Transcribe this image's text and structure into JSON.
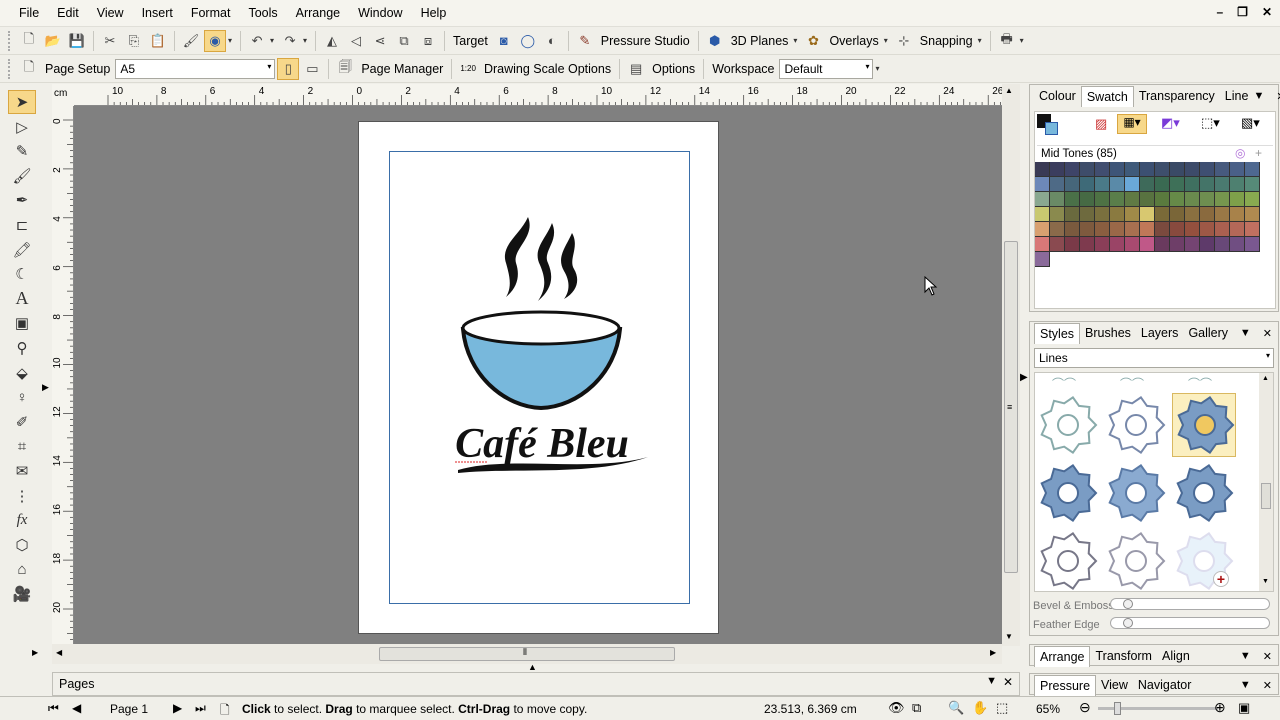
{
  "menu": [
    "File",
    "Edit",
    "View",
    "Insert",
    "Format",
    "Tools",
    "Arrange",
    "Window",
    "Help"
  ],
  "toolbar1": {
    "target_label": "Target",
    "pressure_studio_label": "Pressure Studio",
    "planes_label": "3D Planes",
    "overlays_label": "Overlays",
    "snapping_label": "Snapping"
  },
  "toolbar2": {
    "page_setup_label": "Page Setup",
    "page_size_value": "A5",
    "page_manager_label": "Page Manager",
    "scale_icon_text": "1:20",
    "drawing_scale_label": "Drawing Scale Options",
    "options_label": "Options",
    "workspace_label": "Workspace",
    "workspace_value": "Default"
  },
  "ruler": {
    "unit": "cm",
    "h_ticks": [
      "10",
      "8",
      "6",
      "4",
      "2",
      "0",
      "2",
      "4",
      "6",
      "8",
      "10",
      "12",
      "14",
      "16",
      "18",
      "20",
      "22",
      "24",
      "26"
    ],
    "v_ticks": [
      "0",
      "2",
      "4",
      "6",
      "8",
      "10",
      "12",
      "14",
      "16",
      "18",
      "20"
    ]
  },
  "artwork": {
    "title": "Café Bleu",
    "bowl_color": "#78b8dc"
  },
  "colour_panel": {
    "tabs": [
      "Colour",
      "Swatch",
      "Transparency",
      "Line"
    ],
    "active_tab": "Swatch",
    "palette_name": "Mid Tones (85)",
    "swatch_rows": [
      [
        "#3a3a55",
        "#3b3d5e",
        "#3e4468",
        "#3e4d6a",
        "#414e70",
        "#3e5578",
        "#3f5a7a",
        "#3c5072",
        "#3e4f6c",
        "#3a4a66",
        "#3d4b6a",
        "#3f4f72",
        "#475a7e",
        "#4a6088",
        "#4e6890"
      ],
      [
        "#6d88b8",
        "#4e6a86",
        "#46667a",
        "#3e6a78",
        "#4a7a88",
        "#5a8aa8",
        "#6aa8d8",
        "#3e6a5a",
        "#3a6a52",
        "#3e7058",
        "#3f7060",
        "#447468",
        "#4a7a70",
        "#4e8070",
        "#568a78"
      ],
      [
        "#8aa890",
        "#6a8a66",
        "#4a7048",
        "#466a44",
        "#4e7244",
        "#5a7e4a",
        "#607a44",
        "#587240",
        "#5a7a3e",
        "#668a48",
        "#6a8a4e",
        "#6e8e50",
        "#76964e",
        "#7ea04a",
        "#88aa50"
      ],
      [
        "#c8c870",
        "#8a8a4e",
        "#6a6a3e",
        "#6e6a3e",
        "#7a703e",
        "#8a7a40",
        "#a08a48",
        "#d8c870",
        "#7a6a38",
        "#7a6638",
        "#8a7040",
        "#8a6a3e",
        "#9a7846",
        "#a8824a",
        "#b08a50"
      ],
      [
        "#d8a070",
        "#8a6a4a",
        "#7a5a3e",
        "#7e5a3e",
        "#8a5e40",
        "#9a6848",
        "#a87050",
        "#c07858",
        "#7a4a3e",
        "#884a3e",
        "#94503e",
        "#9e5846",
        "#aa6050",
        "#b46858",
        "#c07060"
      ],
      [
        "#d87878",
        "#8a4a50",
        "#7a3a48",
        "#7e3a4e",
        "#8a3e58",
        "#9a4466",
        "#a84a70",
        "#c05888",
        "#6a3a5e",
        "#6e3e68",
        "#744472",
        "#5e3a6a",
        "#684878",
        "#704e82",
        "#7a5890"
      ],
      [
        "#8a6a9a"
      ]
    ]
  },
  "styles_panel": {
    "tabs": [
      "Styles",
      "Brushes",
      "Layers",
      "Gallery"
    ],
    "active_tab": "Styles",
    "category_value": "Lines",
    "bevel_label": "Bevel & Emboss",
    "feather_label": "Feather Edge"
  },
  "arrange_panel": {
    "tabs": [
      "Arrange",
      "Transform",
      "Align"
    ]
  },
  "navigator_panel": {
    "tabs": [
      "Pressure",
      "View",
      "Navigator"
    ],
    "zoom_value": "65%"
  },
  "pages_bar": {
    "label": "Pages"
  },
  "status": {
    "page_label": "Page 1",
    "hint_bold1": "Click",
    "hint_text1": " to select. ",
    "hint_bold2": "Drag",
    "hint_text2": " to marquee select. ",
    "hint_bold3": "Ctrl-Drag",
    "hint_text3": " to move copy.",
    "coordinates": "23.513,  6.369 cm"
  }
}
